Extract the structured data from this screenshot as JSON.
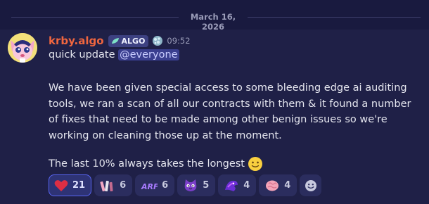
{
  "date_divider": "March 16, 2026",
  "message": {
    "username": "krby.algo",
    "tag_label": "ALGO",
    "timestamp": "09:52",
    "line1_text": "quick update ",
    "mention": "@everyone",
    "paragraph": "We have been given special access to some bleeding edge ai auditing tools, we ran a scan of all our contracts with them & it found a number of fixes that need to be made among other benign issues so we're working on cleaning those up at the moment.",
    "last_line": "The last 10% always takes the longest",
    "inline_emoji": "slightly-smiling-face"
  },
  "reactions": [
    {
      "emoji": "heart",
      "count": "21",
      "active": true
    },
    {
      "emoji": "custom-sticker-pink",
      "count": "6",
      "active": false
    },
    {
      "emoji": "arf",
      "count": "6",
      "active": false
    },
    {
      "emoji": "purple-cat-face",
      "count": "5",
      "active": false
    },
    {
      "emoji": "purple-creature",
      "count": "4",
      "active": false
    },
    {
      "emoji": "pink-brain",
      "count": "4",
      "active": false
    }
  ],
  "colors": {
    "background": "#191a3f",
    "message_bg": "#1f2047",
    "username": "#f0663f",
    "mention_bg": "#3a3f8f",
    "active_reaction_border": "#5865f2"
  }
}
